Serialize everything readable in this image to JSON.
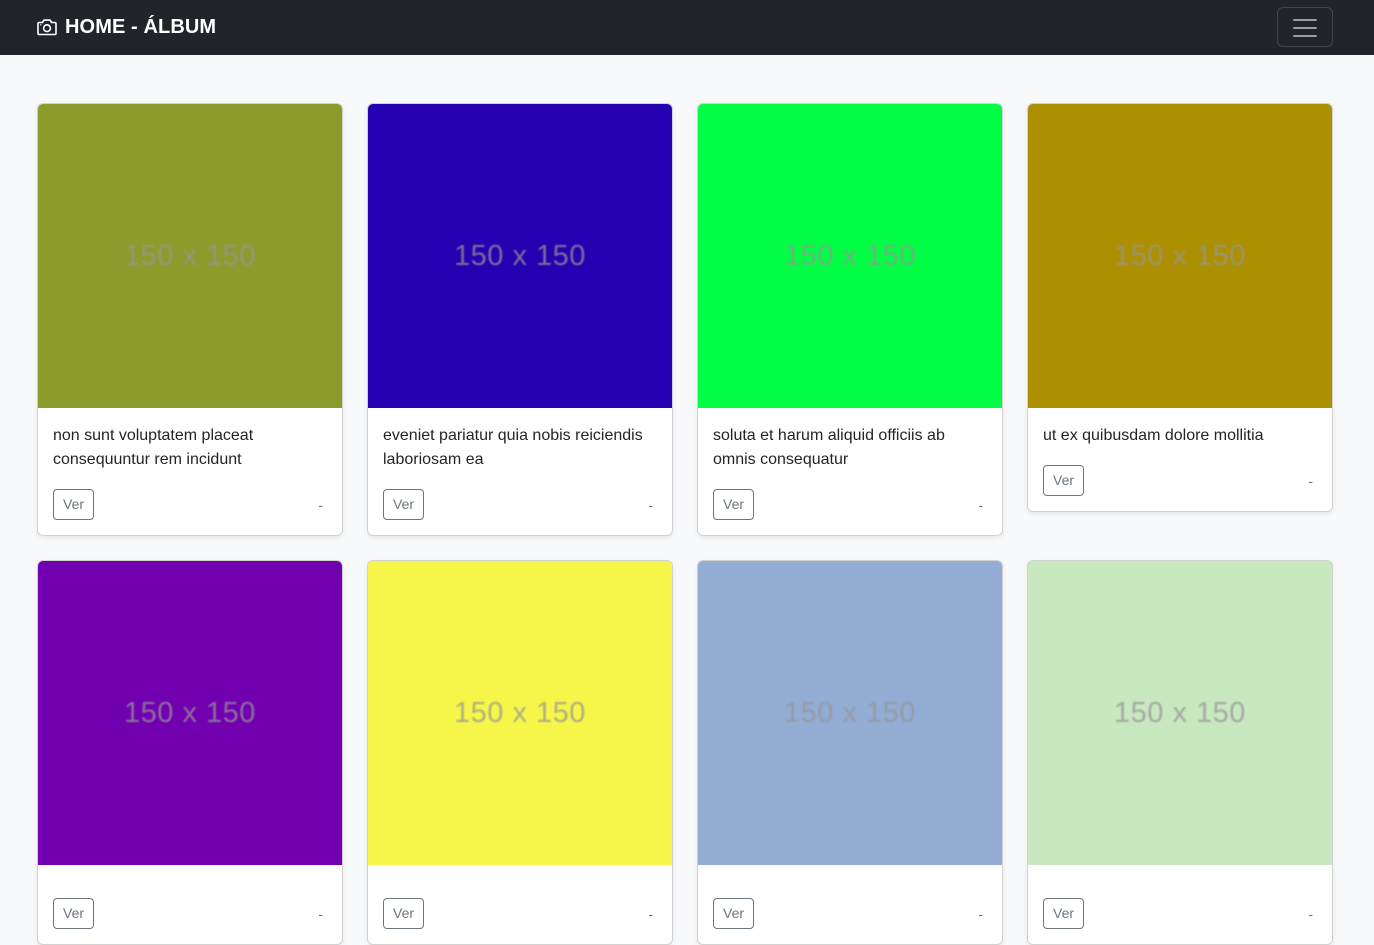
{
  "navbar": {
    "brand": "HOME - ÁLBUM",
    "brand_icon": "camera-icon",
    "toggle_icon": "hamburger-menu-icon",
    "background": "#212529"
  },
  "cards": [
    {
      "color": "#8c9c2c",
      "thumb_label": "150 x 150",
      "title": "non sunt voluptatem placeat consequuntur rem incidunt",
      "button": "Ver",
      "meta": "-"
    },
    {
      "color": "#2400b0",
      "thumb_label": "150 x 150",
      "title": "eveniet pariatur quia nobis reiciendis laboriosam ea",
      "button": "Ver",
      "meta": "-"
    },
    {
      "color": "#00ff44",
      "thumb_label": "150 x 150",
      "title": "soluta et harum aliquid officiis ab omnis consequatur",
      "button": "Ver",
      "meta": "-"
    },
    {
      "color": "#ac9001",
      "thumb_label": "150 x 150",
      "title": "ut ex quibusdam dolore mollitia",
      "button": "Ver",
      "meta": "-"
    },
    {
      "color": "#7000b0",
      "thumb_label": "150 x 150",
      "title": "",
      "button": "Ver",
      "meta": "-"
    },
    {
      "color": "#f6f64a",
      "thumb_label": "150 x 150",
      "title": "",
      "button": "Ver",
      "meta": "-"
    },
    {
      "color": "#92acd4",
      "thumb_label": "150 x 150",
      "title": "",
      "button": "Ver",
      "meta": "-"
    },
    {
      "color": "#c8e8c0",
      "thumb_label": "150 x 150",
      "title": "",
      "button": "Ver",
      "meta": "-"
    }
  ]
}
